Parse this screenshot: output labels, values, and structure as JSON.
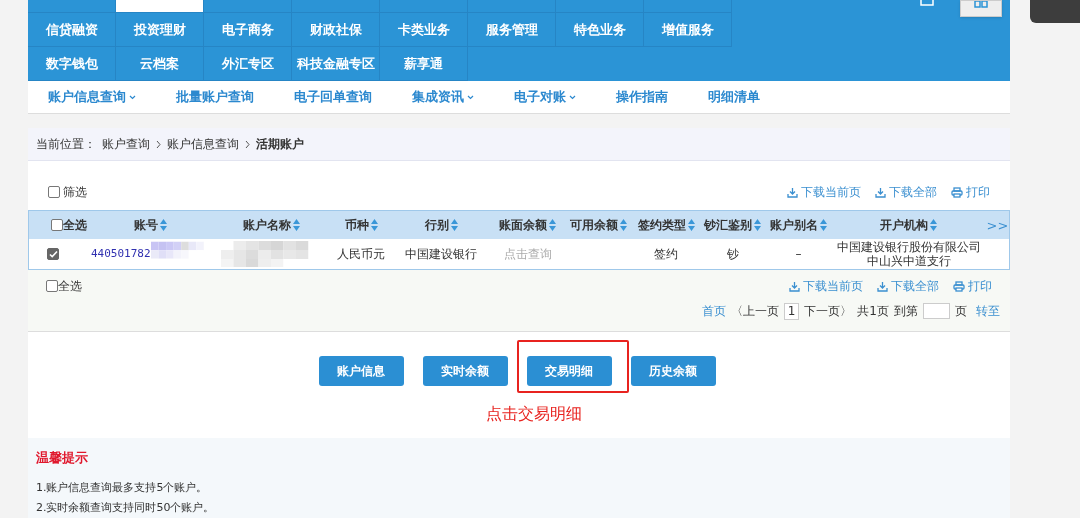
{
  "nav_top_row": [
    {
      "selected": false
    },
    {
      "selected": true
    },
    {
      "selected": false
    },
    {
      "selected": false
    },
    {
      "selected": false
    },
    {
      "selected": false
    },
    {
      "selected": false
    },
    {
      "selected": false
    }
  ],
  "nav_rows": [
    [
      "信贷融资",
      "投资理财",
      "电子商务",
      "财政社保",
      "卡类业务",
      "服务管理",
      "特色业务",
      "增值服务"
    ],
    [
      "数字钱包",
      "云档案",
      "外汇专区",
      "科技金融专区",
      "薪享通"
    ]
  ],
  "sub_nav": [
    {
      "label": "账户信息查询",
      "dropdown": true
    },
    {
      "label": "批量账户查询",
      "dropdown": false
    },
    {
      "label": "电子回单查询",
      "dropdown": false
    },
    {
      "label": "集成资讯",
      "dropdown": true
    },
    {
      "label": "电子对账",
      "dropdown": true
    },
    {
      "label": "操作指南",
      "dropdown": false
    },
    {
      "label": "明细清单",
      "dropdown": false
    }
  ],
  "breadcrumb": {
    "prefix": "当前位置：",
    "items": [
      "账户查询",
      "账户信息查询"
    ],
    "current": "活期账户"
  },
  "filter": {
    "label": "筛选",
    "checked": false
  },
  "actions": [
    "下载当前页",
    "下载全部",
    "打印"
  ],
  "table": {
    "select_all": {
      "label": "全选",
      "checked": false
    },
    "columns": [
      "账号",
      "账户名称",
      "币种",
      "行别",
      "账面余额",
      "可用余额",
      "签约类型",
      "钞汇鉴别",
      "账户别名",
      "开户机构"
    ],
    "more": ">>",
    "rows": [
      {
        "checked": true,
        "account_redacted": true,
        "name_redacted": true,
        "cells": [
          "440501782",
          "",
          "人民币元",
          "中国建设银行",
          "点击查询",
          "",
          "签约",
          "钞",
          "–",
          "中国建设银行股份有限公司中山兴中道支行"
        ]
      }
    ]
  },
  "footer": {
    "select_all": {
      "label": "全选",
      "checked": false
    },
    "actions": [
      "下载当前页",
      "下载全部",
      "打印"
    ],
    "pagination": {
      "first": "首页",
      "prev": "〈上一页",
      "page": "1",
      "next": "下一页〉",
      "total": "共1页",
      "goto_prefix": "到第",
      "goto_suffix": "页",
      "go": "转至"
    }
  },
  "buttons": [
    {
      "label": "账户信息",
      "highlighted": false
    },
    {
      "label": "实时余额",
      "highlighted": false
    },
    {
      "label": "交易明细",
      "highlighted": true
    },
    {
      "label": "历史余额",
      "highlighted": false
    }
  ],
  "annotation": "点击交易明细",
  "tips": {
    "title": "温馨提示",
    "items": [
      "1.账户信息查询最多支持5个账户。",
      "2.实时余额查询支持同时50个账户。"
    ]
  }
}
